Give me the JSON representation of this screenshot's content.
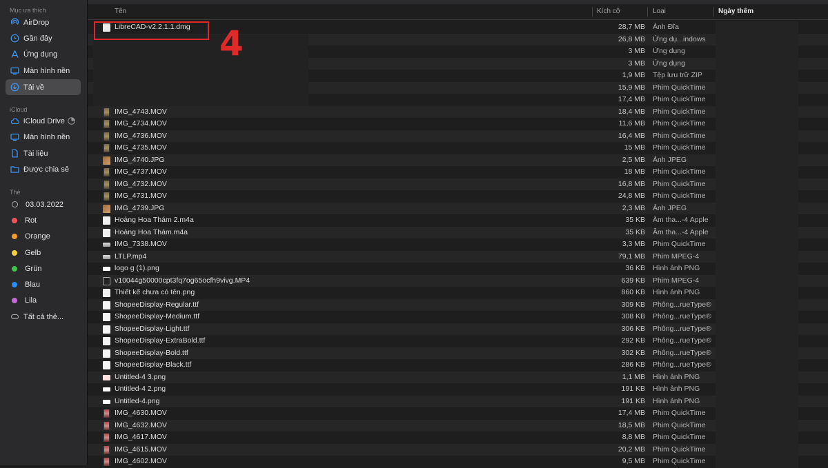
{
  "sidebar": {
    "favorites_title": "Mục ưa thích",
    "favorites": [
      {
        "label": "AirDrop",
        "icon": "airdrop-icon"
      },
      {
        "label": "Gần đây",
        "icon": "clock-icon"
      },
      {
        "label": "Ứng dụng",
        "icon": "applications-icon"
      },
      {
        "label": "Màn hình nền",
        "icon": "desktop-icon"
      },
      {
        "label": "Tải về",
        "icon": "downloads-icon",
        "selected": true
      }
    ],
    "icloud_title": "iCloud",
    "icloud": [
      {
        "label": "iCloud Drive",
        "icon": "cloud-icon"
      },
      {
        "label": "Màn hình nền",
        "icon": "desktop-icon"
      },
      {
        "label": "Tài liệu",
        "icon": "document-icon"
      },
      {
        "label": "Được chia sẻ",
        "icon": "shared-folder-icon"
      }
    ],
    "tags_title": "Thẻ",
    "tags": [
      {
        "label": "03.03.2022",
        "color": ""
      },
      {
        "label": "Rot",
        "color": "#f05454"
      },
      {
        "label": "Orange",
        "color": "#f39a2c"
      },
      {
        "label": "Gelb",
        "color": "#f4d13a"
      },
      {
        "label": "Grün",
        "color": "#3ec24a"
      },
      {
        "label": "Blau",
        "color": "#2d8cf0"
      },
      {
        "label": "Lila",
        "color": "#c66ad8"
      },
      {
        "label": "Tất cả thẻ...",
        "color": ""
      }
    ]
  },
  "columns": {
    "name": "Tên",
    "size": "Kích cỡ",
    "kind": "Loại",
    "date": "Ngày thêm"
  },
  "annotation": {
    "step_number": "4"
  },
  "files": [
    {
      "name": "LibreCAD-v2.2.1.1.dmg",
      "size": "28,7 MB",
      "kind": "Ảnh Đĩa",
      "icon": "doc"
    },
    {
      "name": "",
      "size": "26,8 MB",
      "kind": "Ứng dụ...indows",
      "icon": ""
    },
    {
      "name": "",
      "size": "3 MB",
      "kind": "Ứng dụng",
      "icon": ""
    },
    {
      "name": "",
      "size": "3 MB",
      "kind": "Ứng dụng",
      "icon": ""
    },
    {
      "name": "",
      "size": "1,9 MB",
      "kind": "Tệp lưu trữ ZIP",
      "icon": ""
    },
    {
      "name": "",
      "size": "15,9 MB",
      "kind": "Phim QuickTime",
      "icon": ""
    },
    {
      "name": "",
      "size": "17,4 MB",
      "kind": "Phim QuickTime",
      "icon": ""
    },
    {
      "name": "IMG_4743.MOV",
      "size": "18,4 MB",
      "kind": "Phim QuickTime",
      "icon": "video"
    },
    {
      "name": "IMG_4734.MOV",
      "size": "11,6 MB",
      "kind": "Phim QuickTime",
      "icon": "video"
    },
    {
      "name": "IMG_4736.MOV",
      "size": "16,4 MB",
      "kind": "Phim QuickTime",
      "icon": "video"
    },
    {
      "name": "IMG_4735.MOV",
      "size": "15 MB",
      "kind": "Phim QuickTime",
      "icon": "video"
    },
    {
      "name": "IMG_4740.JPG",
      "size": "2,5 MB",
      "kind": "Ảnh JPEG",
      "icon": "jpg"
    },
    {
      "name": "IMG_4737.MOV",
      "size": "18 MB",
      "kind": "Phim QuickTime",
      "icon": "video"
    },
    {
      "name": "IMG_4732.MOV",
      "size": "16,8 MB",
      "kind": "Phim QuickTime",
      "icon": "video"
    },
    {
      "name": "IMG_4731.MOV",
      "size": "24,8 MB",
      "kind": "Phim QuickTime",
      "icon": "video"
    },
    {
      "name": "IMG_4739.JPG",
      "size": "2,3 MB",
      "kind": "Ảnh JPEG",
      "icon": "jpg"
    },
    {
      "name": "Hoàng Hoa Thám 2.m4a",
      "size": "35 KB",
      "kind": "Âm tha...-4 Apple",
      "icon": "audio"
    },
    {
      "name": "Hoàng Hoa Thám.m4a",
      "size": "35 KB",
      "kind": "Âm tha...-4 Apple",
      "icon": "audio"
    },
    {
      "name": "IMG_7338.MOV",
      "size": "3,3 MB",
      "kind": "Phim QuickTime",
      "icon": "wide"
    },
    {
      "name": "LTLP.mp4",
      "size": "79,1 MB",
      "kind": "Phim MPEG-4",
      "icon": "wide"
    },
    {
      "name": "logo g (1).png",
      "size": "36 KB",
      "kind": "Hình ảnh PNG",
      "icon": "png"
    },
    {
      "name": "v10044g50000cpt3fq7og65ocfh9vivg.MP4",
      "size": "639 KB",
      "kind": "Phim MPEG-4",
      "icon": "mp4b"
    },
    {
      "name": "Thiết kế chưa có tên.png",
      "size": "860 KB",
      "kind": "Hình ảnh PNG",
      "icon": "audio"
    },
    {
      "name": "ShopeeDisplay-Regular.ttf",
      "size": "309 KB",
      "kind": "Phông...rueType®",
      "icon": "font"
    },
    {
      "name": "ShopeeDisplay-Medium.ttf",
      "size": "308 KB",
      "kind": "Phông...rueType®",
      "icon": "font"
    },
    {
      "name": "ShopeeDisplay-Light.ttf",
      "size": "306 KB",
      "kind": "Phông...rueType®",
      "icon": "font"
    },
    {
      "name": "ShopeeDisplay-ExtraBold.ttf",
      "size": "292 KB",
      "kind": "Phông...rueType®",
      "icon": "font"
    },
    {
      "name": "ShopeeDisplay-Bold.ttf",
      "size": "302 KB",
      "kind": "Phông...rueType®",
      "icon": "font"
    },
    {
      "name": "ShopeeDisplay-Black.ttf",
      "size": "286 KB",
      "kind": "Phông...rueType®",
      "icon": "font"
    },
    {
      "name": "Untitled-4 3.png",
      "size": "1,1 MB",
      "kind": "Hình ảnh PNG",
      "icon": "pink"
    },
    {
      "name": "Untitled-4 2.png",
      "size": "191 KB",
      "kind": "Hình ảnh PNG",
      "icon": "png"
    },
    {
      "name": "Untitled-4.png",
      "size": "191 KB",
      "kind": "Hình ảnh PNG",
      "icon": "png"
    },
    {
      "name": "IMG_4630.MOV",
      "size": "17,4 MB",
      "kind": "Phim QuickTime",
      "icon": "video2"
    },
    {
      "name": "IMG_4632.MOV",
      "size": "18,5 MB",
      "kind": "Phim QuickTime",
      "icon": "video2"
    },
    {
      "name": "IMG_4617.MOV",
      "size": "8,8 MB",
      "kind": "Phim QuickTime",
      "icon": "video2"
    },
    {
      "name": "IMG_4615.MOV",
      "size": "20,2 MB",
      "kind": "Phim QuickTime",
      "icon": "video2"
    },
    {
      "name": "IMG_4602.MOV",
      "size": "9,5 MB",
      "kind": "Phim QuickTime",
      "icon": "video2"
    }
  ]
}
